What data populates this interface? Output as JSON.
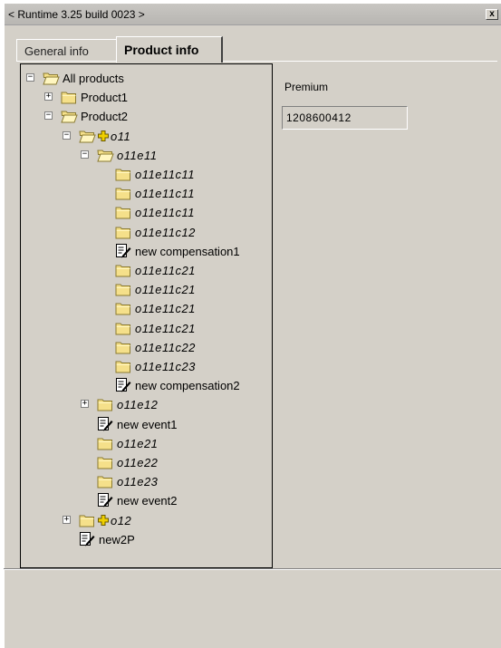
{
  "window": {
    "title": "< Runtime 3.25 build 0023 >",
    "close_label": "x"
  },
  "tabs": [
    {
      "label": "General info",
      "active": false
    },
    {
      "label": "Product info",
      "active": true
    }
  ],
  "tree": [
    {
      "label": "All products",
      "icon": "folder-open-icon",
      "expander": "−",
      "italic": false,
      "plus": false
    },
    {
      "label": "Product1",
      "icon": "folder-icon",
      "expander": "+",
      "italic": false,
      "plus": false
    },
    {
      "label": "Product2",
      "icon": "folder-open-icon",
      "expander": "−",
      "italic": false,
      "plus": false
    },
    {
      "label": "o11",
      "icon": "folder-open-icon",
      "expander": "−",
      "italic": true,
      "plus": true
    },
    {
      "label": "o11e11",
      "icon": "folder-open-icon",
      "expander": "−",
      "italic": true,
      "plus": false
    },
    {
      "label": "o11e11c11",
      "icon": "folder-icon",
      "expander": "",
      "italic": true,
      "plus": false
    },
    {
      "label": "o11e11c11",
      "icon": "folder-icon",
      "expander": "",
      "italic": true,
      "plus": false
    },
    {
      "label": "o11e11c11",
      "icon": "folder-icon",
      "expander": "",
      "italic": true,
      "plus": false
    },
    {
      "label": "o11e11c12",
      "icon": "folder-icon",
      "expander": "",
      "italic": true,
      "plus": false
    },
    {
      "label": "new compensation1",
      "icon": "document-icon",
      "expander": "",
      "italic": false,
      "plus": false
    },
    {
      "label": "o11e11c21",
      "icon": "folder-icon",
      "expander": "",
      "italic": true,
      "plus": false
    },
    {
      "label": "o11e11c21",
      "icon": "folder-icon",
      "expander": "",
      "italic": true,
      "plus": false
    },
    {
      "label": "o11e11c21",
      "icon": "folder-icon",
      "expander": "",
      "italic": true,
      "plus": false
    },
    {
      "label": "o11e11c21",
      "icon": "folder-icon",
      "expander": "",
      "italic": true,
      "plus": false
    },
    {
      "label": "o11e11c22",
      "icon": "folder-icon",
      "expander": "",
      "italic": true,
      "plus": false
    },
    {
      "label": "o11e11c23",
      "icon": "folder-icon",
      "expander": "",
      "italic": true,
      "plus": false
    },
    {
      "label": "new compensation2",
      "icon": "document-icon",
      "expander": "",
      "italic": false,
      "plus": false
    },
    {
      "label": "o11e12",
      "icon": "folder-icon",
      "expander": "+",
      "italic": true,
      "plus": false
    },
    {
      "label": "new event1",
      "icon": "document-icon",
      "expander": "",
      "italic": false,
      "plus": false
    },
    {
      "label": "o11e21",
      "icon": "folder-icon",
      "expander": "",
      "italic": true,
      "plus": false
    },
    {
      "label": "o11e22",
      "icon": "folder-icon",
      "expander": "",
      "italic": true,
      "plus": false
    },
    {
      "label": "o11e23",
      "icon": "folder-icon",
      "expander": "",
      "italic": true,
      "plus": false
    },
    {
      "label": "new event2",
      "icon": "document-icon",
      "expander": "",
      "italic": false,
      "plus": false
    },
    {
      "label": "o12",
      "icon": "folder-icon",
      "expander": "+",
      "italic": true,
      "plus": true
    },
    {
      "label": "new2P",
      "icon": "document-icon",
      "expander": "",
      "italic": false,
      "plus": false
    }
  ],
  "details": {
    "premium_label": "Premium",
    "premium_value": "1208600412"
  },
  "colors": {
    "window_bg": "#d4d0c8",
    "folder_fill": "#f5e08a",
    "folder_edge": "#8a7a30",
    "plus_fill": "#f0d000"
  }
}
